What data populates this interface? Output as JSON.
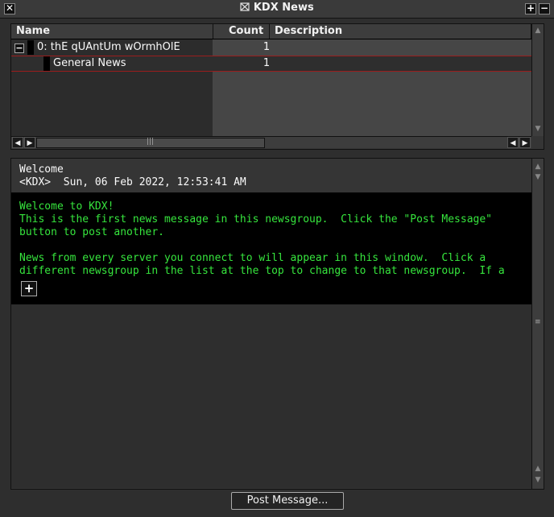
{
  "window": {
    "title": "KDX News",
    "close_glyph": "✕",
    "plus_glyph": "+",
    "minus_glyph": "−"
  },
  "tree": {
    "columns": [
      "Name",
      "Count",
      "Description"
    ],
    "rows": [
      {
        "name": "0: thE qUAntUm wOrmhOlE",
        "count": "1",
        "expander": "−"
      },
      {
        "name": "General News",
        "count": "1"
      }
    ]
  },
  "news": {
    "subject": "Welcome",
    "meta": "<KDX>  Sun, 06 Feb 2022, 12:53:41 AM",
    "lines": [
      "Welcome to KDX!",
      "This is the first news message in this newsgroup.  Click the \"Post Message\"",
      "button to post another.",
      "",
      "News from every server you connect to will appear in this window.  Click a",
      "different newsgroup in the list at the top to change to that newsgroup.  If a"
    ],
    "expand_glyph": "+"
  },
  "actions": {
    "post_label": "Post Message..."
  }
}
